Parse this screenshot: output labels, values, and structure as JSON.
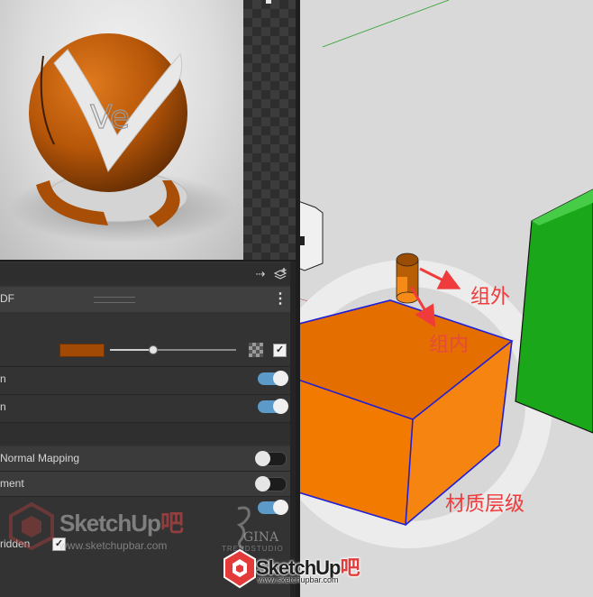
{
  "material_editor": {
    "header": {
      "title": "DF",
      "menu_icon": "kebab-menu-icon"
    },
    "toolbar": {
      "icons": [
        "arrow-link-icon",
        "add-layer-icon"
      ]
    },
    "rows": {
      "color": {
        "swatch_color": "#a04a05",
        "slider_value": 0.33,
        "checked": true
      },
      "toggle_row_1": {
        "label": "n",
        "enabled": true
      },
      "toggle_row_2": {
        "label": "n",
        "enabled": true
      },
      "normal_mapping": {
        "label": "Normal Mapping",
        "enabled": false
      },
      "displacement": {
        "label": "ment",
        "enabled": false
      },
      "toggle_row_5": {
        "enabled": true
      },
      "overridden": {
        "label": "ridden",
        "checked": true
      }
    }
  },
  "watermarks": {
    "panel_brand": "SketchUp",
    "panel_brand_suffix": "吧",
    "panel_url": "www.sketchupbar.com",
    "gina": "GINA",
    "gina_sub": "TRENDSTUDIO",
    "bottom_brand": "SketchUp",
    "bottom_brand_suffix": "吧",
    "bottom_url": "www.sketchupbar.com"
  },
  "viewport": {
    "annotations": {
      "outer": "组外",
      "inner": "组内",
      "material_level": "材质层级"
    },
    "colors": {
      "orange_box": "#f27a00",
      "green_box": "#1db31d",
      "selection_blue": "#1f1fd6",
      "annotation_red": "#ef3b3b"
    }
  }
}
